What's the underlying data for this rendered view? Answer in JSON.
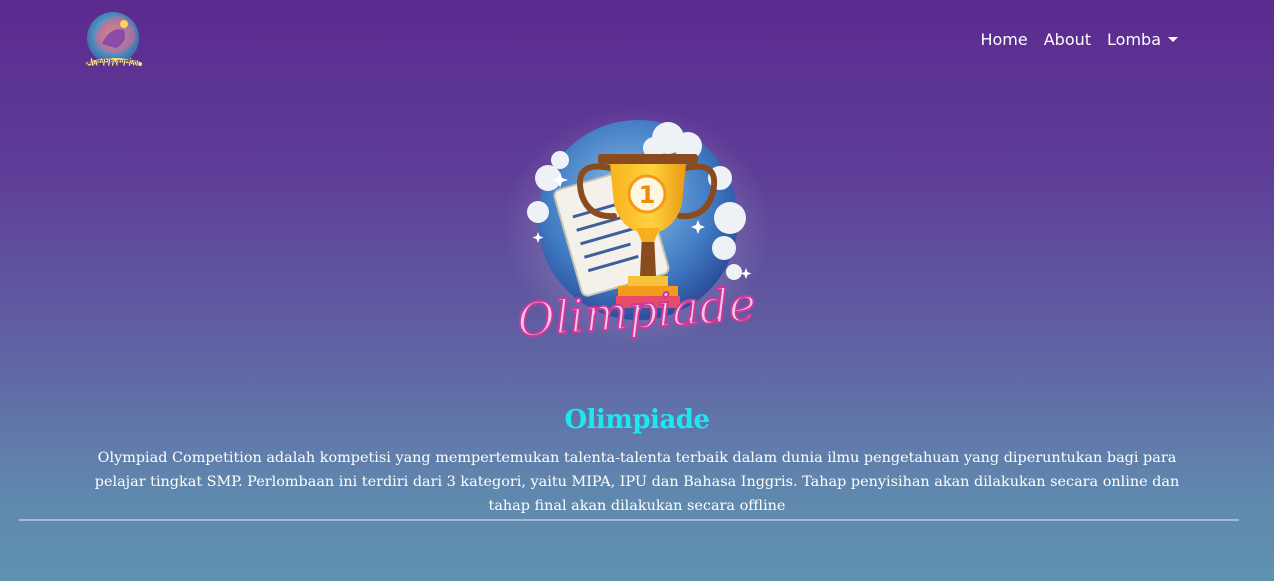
{
  "brand": {
    "logo_text": "Aetheria"
  },
  "nav": {
    "items": [
      {
        "label": "Home"
      },
      {
        "label": "About"
      },
      {
        "label": "Lomba"
      }
    ]
  },
  "hero": {
    "image_text": "Olimpiade",
    "badge_number": "1"
  },
  "content": {
    "title": "Olimpiade",
    "description": "Olympiad Competition adalah kompetisi yang mempertemukan talenta-talenta terbaik dalam dunia ilmu pengetahuan yang diperuntukan bagi para pelajar tingkat SMP. Perlombaan ini terdiri dari 3 kategori, yaitu MIPA, IPU dan Bahasa Inggris. Tahap penyisihan akan dilakukan secara online dan tahap final akan dilakukan secara offline"
  },
  "colors": {
    "title_accent": "#1ee7f0",
    "background_top": "#5b2a8f",
    "background_bottom": "#6092b0"
  }
}
